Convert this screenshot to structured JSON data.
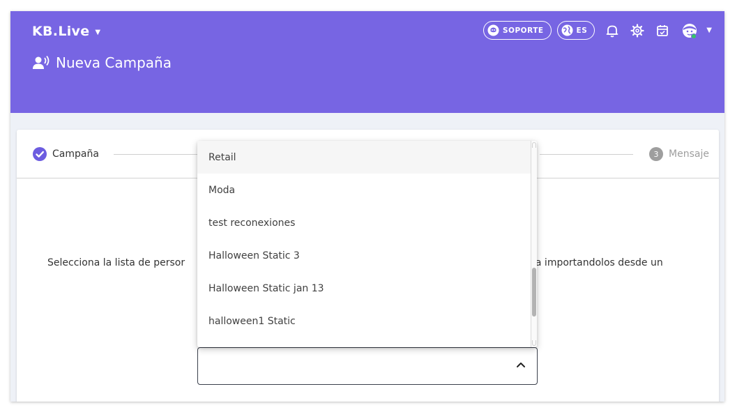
{
  "header": {
    "brand": "KB.Live",
    "page_title": "Nueva Campaña",
    "support_label": "SOPORTE",
    "language_label": "ES",
    "background_color": "#7765e3"
  },
  "stepper": {
    "step1_label": "Campaña",
    "step3_number": "3",
    "step3_label": "Mensaje"
  },
  "body": {
    "description_left": "Selecciona la lista de persor",
    "description_right": "eva importandolos desde un"
  },
  "dropdown": {
    "options": [
      "Retail",
      "Moda",
      "test reconexiones",
      "Halloween Static 3",
      "Halloween Static jan 13",
      "halloween1 Static"
    ],
    "selected_value": ""
  }
}
